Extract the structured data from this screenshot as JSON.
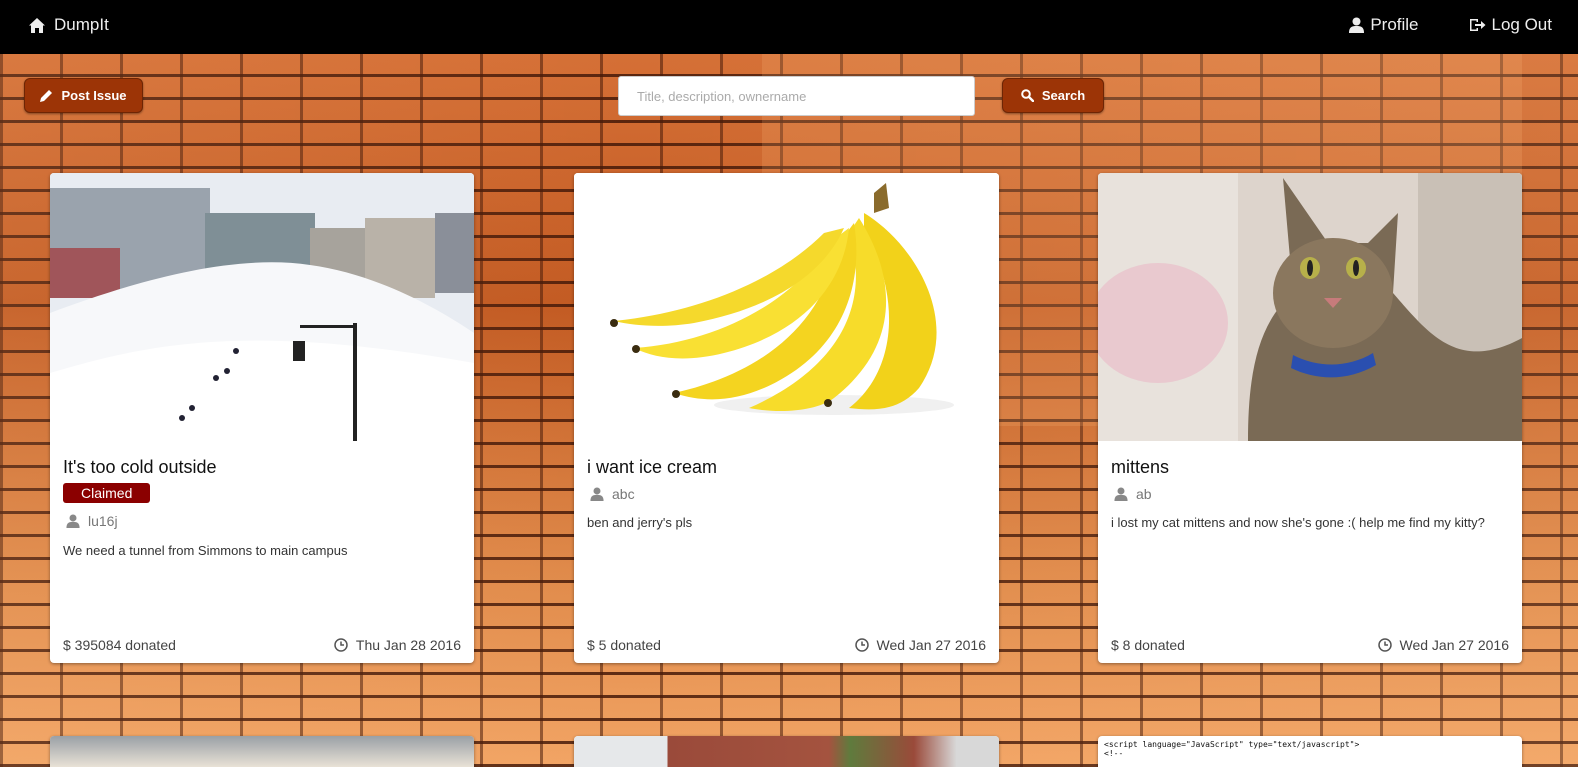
{
  "nav": {
    "brand": "DumpIt",
    "profile": "Profile",
    "logout": "Log Out"
  },
  "toolbar": {
    "post_issue": "Post Issue",
    "search_placeholder": "Title, description, ownername",
    "search_button": "Search"
  },
  "cards": [
    {
      "title": "It's too cold outside",
      "badge": "Claimed",
      "owner": "lu16j",
      "description": "We need a tunnel from Simmons to main campus",
      "donated": "$ 395084 donated",
      "date": "Thu Jan 28 2016"
    },
    {
      "title": "i want ice cream",
      "owner": "abc",
      "description": "ben and jerry's pls",
      "donated": "$ 5 donated",
      "date": "Wed Jan 27 2016"
    },
    {
      "title": "mittens",
      "owner": "ab",
      "description": "i lost my cat mittens and now she's gone :( help me find my kitty?",
      "donated": "$ 8 donated",
      "date": "Wed Jan 27 2016"
    }
  ],
  "partial_card_code": [
    "<script language=\"JavaScript\" type=\"text/javascript\">",
    "<!--"
  ],
  "colors": {
    "navbar": "#000000",
    "button_brown": "#9c3406",
    "badge_claimed": "#8b0000",
    "brick": "#c8612a"
  }
}
